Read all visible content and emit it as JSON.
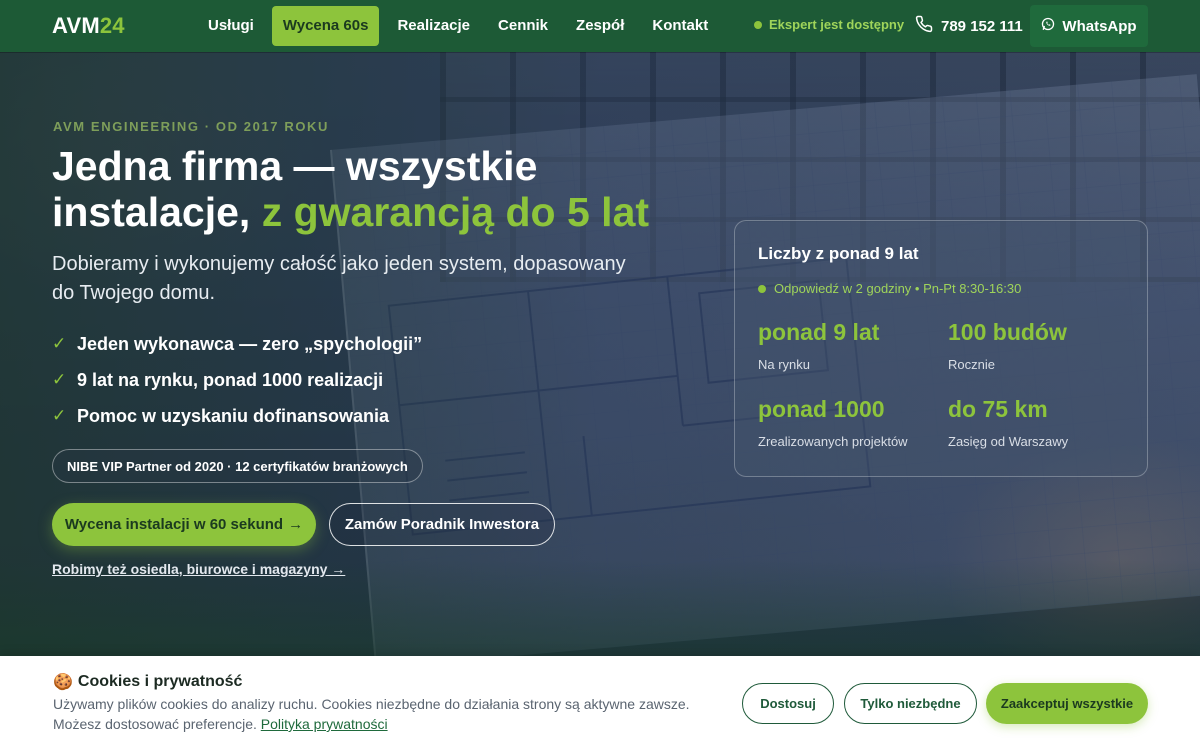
{
  "nav": {
    "logo_main": "AVM",
    "logo_accent": "24",
    "links": [
      "Usługi",
      "Wycena 60s",
      "Realizacje",
      "Cennik",
      "Zespół",
      "Kontakt"
    ],
    "expert_status": "Ekspert jest dostępny",
    "phone": "789 152 111",
    "whatsapp": "WhatsApp"
  },
  "hero": {
    "eyebrow": "AVM ENGINEERING · OD 2017 ROKU",
    "headline_white": "Jedna firma — wszystkie instalacje,",
    "headline_green": "z gwarancją do 5 lat",
    "subhead": "Dobieramy i wykonujemy całość jako jeden system, dopasowany do Twojego domu.",
    "checklist": [
      "Jeden wykonawca — zero „spychologii”",
      "9 lat na rynku, ponad 1000 realizacji",
      "Pomoc w uzyskaniu dofinansowania"
    ],
    "badge": "NIBE VIP Partner od 2020 · 12 certyfikatów branżowych",
    "cta_primary": "Wycena instalacji w 60 sekund",
    "cta_primary_arrow": "→",
    "cta_secondary": "Zamów Poradnik Inwestora",
    "link": "Robimy też osiedla, biurowce i magazyny →"
  },
  "stats": {
    "title": "Liczby z ponad 9 lat",
    "response": "Odpowiedź w 2 godziny • Pn-Pt 8:30-16:30",
    "items": [
      {
        "value": "ponad 9 lat",
        "label": "Na rynku"
      },
      {
        "value": "100 budów",
        "label": "Rocznie"
      },
      {
        "value": "ponad 1000",
        "label": "Zrealizowanych projektów"
      },
      {
        "value": "do 75 km",
        "label": "Zasięg od Warszawy"
      }
    ]
  },
  "cookies": {
    "icon": "🍪",
    "title": "Cookies i prywatność",
    "text": "Używamy plików cookies do analizy ruchu. Cookies niezbędne do działania strony są aktywne zawsze. Możesz dostosować preferencje.",
    "link": "Polityka prywatności",
    "btn_customize": "Dostosuj",
    "btn_necessary": "Tylko niezbędne",
    "btn_accept": "Zaakceptuj wszystkie"
  },
  "colors": {
    "brand_green": "#1d5a36",
    "accent_lime": "#8dc43c",
    "status_green": "#9fd45a"
  },
  "icons": {
    "phone": "phone-icon",
    "whatsapp": "whatsapp-icon",
    "check": "check-icon",
    "status_dot": "status-dot-icon",
    "cookie": "cookie-icon"
  }
}
